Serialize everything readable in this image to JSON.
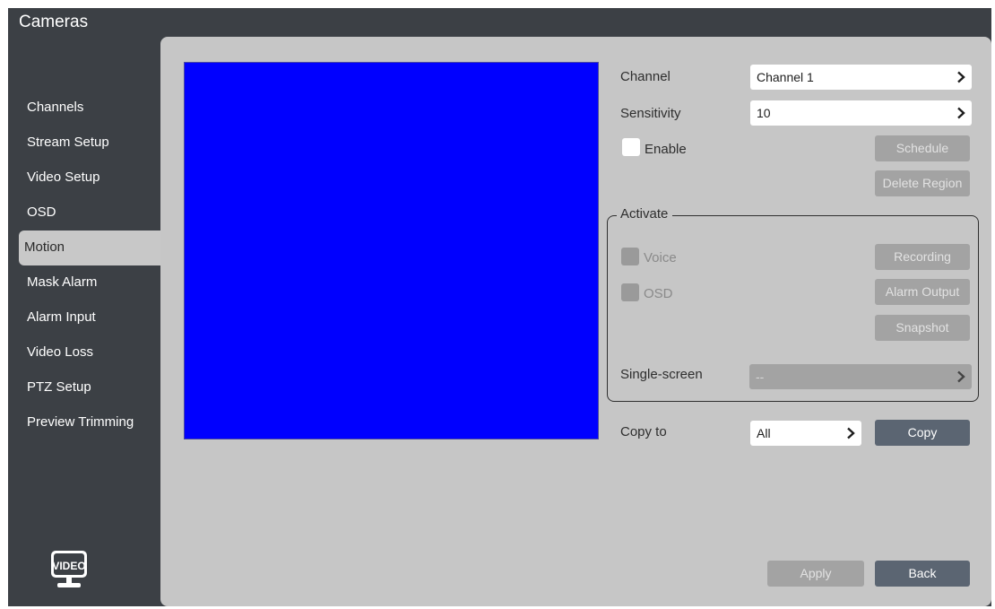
{
  "app": {
    "title": "Cameras"
  },
  "sidebar": {
    "items": [
      {
        "label": "Channels"
      },
      {
        "label": "Stream Setup"
      },
      {
        "label": "Video Setup"
      },
      {
        "label": "OSD"
      },
      {
        "label": "Motion",
        "active": true
      },
      {
        "label": "Mask Alarm"
      },
      {
        "label": "Alarm Input"
      },
      {
        "label": "Video Loss"
      },
      {
        "label": "PTZ Setup"
      },
      {
        "label": "Preview Trimming"
      }
    ],
    "logo_text": "VIDEO"
  },
  "motion": {
    "channel": {
      "label": "Channel",
      "value": "Channel 1"
    },
    "sensitivity": {
      "label": "Sensitivity",
      "value": "10"
    },
    "enable": {
      "label": "Enable",
      "checked": false
    },
    "schedule_label": "Schedule",
    "delete_region_label": "Delete Region",
    "activate": {
      "legend": "Activate",
      "voice": {
        "label": "Voice",
        "checked": false,
        "disabled": true
      },
      "osd": {
        "label": "OSD",
        "checked": false,
        "disabled": true
      },
      "recording_label": "Recording",
      "alarm_output_label": "Alarm Output",
      "snapshot_label": "Snapshot",
      "single_screen": {
        "label": "Single-screen",
        "value": "--"
      }
    },
    "copy_to": {
      "label": "Copy to",
      "value": "All"
    },
    "copy_label": "Copy"
  },
  "footer": {
    "apply_label": "Apply",
    "back_label": "Back"
  },
  "colors": {
    "preview": "#0000ff",
    "sidebar_bg": "#3c4045",
    "panel_bg": "#c6c6c6",
    "primary_button": "#5b6572",
    "disabled_button": "#a3a3a3"
  },
  "icons": {
    "chevron": "chevron-right-icon",
    "logo": "video-monitor-icon"
  }
}
